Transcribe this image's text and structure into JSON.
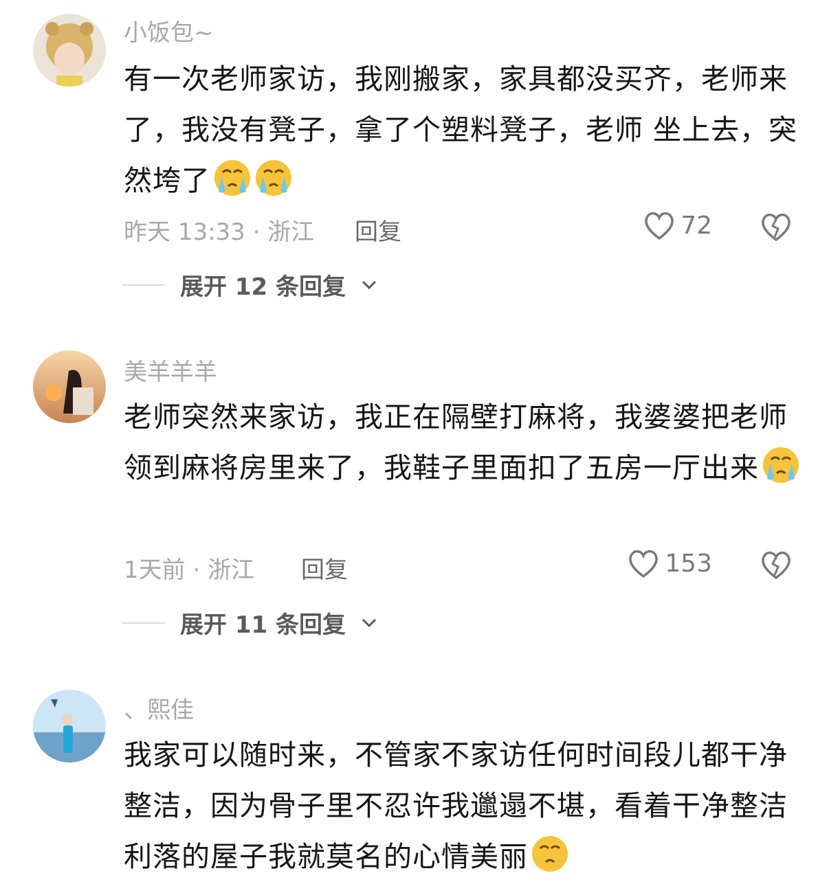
{
  "comments": [
    {
      "username": "小饭包~",
      "text": "有一次老师家访，我刚搬家，家具都没买齐，老师来了，我没有凳子，拿了个塑料凳子，老师 坐上去，突然垮了",
      "emoji_count": 2,
      "time": "昨天 13:33",
      "location": "浙江",
      "reply_label": "回复",
      "likes": "72",
      "expand_label": "展开 12 条回复",
      "avatar_icon": "avatar-bear-hat-girl"
    },
    {
      "username": "美羊羊羊",
      "text": "老师突然来家访，我正在隔壁打麻将，我婆婆把老师领到麻将房里来了，我鞋子里面扣了五房一厅出来",
      "emoji_count": 1,
      "time": "1天前",
      "location": "浙江",
      "reply_label": "回复",
      "likes": "153",
      "expand_label": "展开 11 条回复",
      "avatar_icon": "avatar-sunset-girl"
    },
    {
      "username": "、熙佳",
      "text": "我家可以随时来，不管家不家访任何时间段儿都干净整洁，因为骨子里不忍许我邋遢不堪，看着干净整洁利落的屋子我就莫名的心情美丽",
      "emoji_count": 1,
      "avatar_icon": "avatar-beach-girl"
    }
  ],
  "colors": {
    "text": "#161616",
    "meta": "#a8a8a8",
    "accent_emoji": "#f6c33a"
  }
}
